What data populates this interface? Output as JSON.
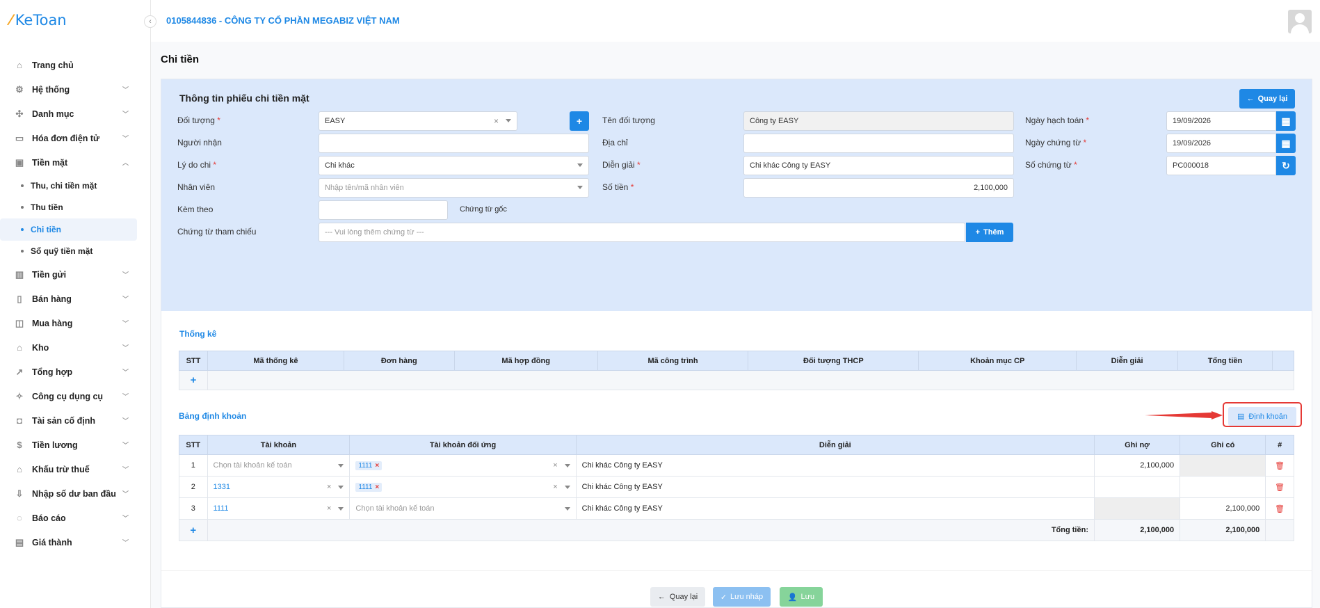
{
  "app": {
    "logo_text": "KeToan",
    "company": "0105844836 - CÔNG TY CỔ PHẦN MEGABIZ VIỆT NAM"
  },
  "sidebar": {
    "items": [
      {
        "label": "Trang chủ",
        "icon": "home-icon"
      },
      {
        "label": "Hệ thống",
        "icon": "gear-icon"
      },
      {
        "label": "Danh mục",
        "icon": "grid-icon"
      },
      {
        "label": "Hóa đơn điện tử",
        "icon": "invoice-icon"
      },
      {
        "label": "Tiền mặt",
        "icon": "cash-icon"
      },
      {
        "label": "Tiền gửi",
        "icon": "bank-icon"
      },
      {
        "label": "Bán hàng",
        "icon": "sale-icon"
      },
      {
        "label": "Mua hàng",
        "icon": "cart-icon"
      },
      {
        "label": "Kho",
        "icon": "warehouse-icon"
      },
      {
        "label": "Tổng hợp",
        "icon": "chart-icon"
      },
      {
        "label": "Công cụ dụng cụ",
        "icon": "tool-icon"
      },
      {
        "label": "Tài sản cố định",
        "icon": "car-icon"
      },
      {
        "label": "Tiền lương",
        "icon": "dollar-icon"
      },
      {
        "label": "Khấu trừ thuế",
        "icon": "tax-icon"
      },
      {
        "label": "Nhập số dư ban đầu",
        "icon": "import-icon"
      },
      {
        "label": "Báo cáo",
        "icon": "report-icon"
      },
      {
        "label": "Giá thành",
        "icon": "price-icon"
      }
    ],
    "subitems": [
      "Thu, chi tiền mặt",
      "Thu tiền",
      "Chi tiền",
      "Sổ quỹ tiền mặt"
    ]
  },
  "page": {
    "title": "Chi tiền",
    "form_title": "Thông tin phiếu chi tiền mặt",
    "back_label": "Quay lại"
  },
  "form": {
    "doi_tuong_label": "Đối tượng",
    "doi_tuong_value": "EASY",
    "ten_doi_tuong_label": "Tên đối tượng",
    "ten_doi_tuong_value": "Công ty EASY",
    "ngay_hach_toan_label": "Ngày hạch toán",
    "ngay_hach_toan_value": "19/09/2026",
    "nguoi_nhan_label": "Người nhận",
    "nguoi_nhan_value": "",
    "dia_chi_label": "Địa chỉ",
    "dia_chi_value": "",
    "ngay_chung_tu_label": "Ngày chứng từ",
    "ngay_chung_tu_value": "19/09/2026",
    "ly_do_chi_label": "Lý do chi",
    "ly_do_chi_value": "Chi khác",
    "dien_giai_label": "Diễn giải",
    "dien_giai_value": "Chi khác Công ty EASY",
    "so_chung_tu_label": "Số chứng từ",
    "so_chung_tu_value": "PC000018",
    "nhan_vien_label": "Nhân viên",
    "nhan_vien_placeholder": "Nhập tên/mã nhân viên",
    "so_tien_label": "Số tiền",
    "so_tien_value": "2,100,000",
    "kem_theo_label": "Kèm theo",
    "kem_theo_value": "",
    "chung_tu_goc_label": "Chứng từ gốc",
    "chung_tu_tham_chieu_label": "Chứng từ tham chiếu",
    "chung_tu_tham_chieu_placeholder": "--- Vui lòng thêm chứng từ ---",
    "them_label": "Thêm"
  },
  "thong_ke": {
    "title": "Thống kê",
    "columns": [
      "STT",
      "Mã thống kê",
      "Đơn hàng",
      "Mã hợp đồng",
      "Mã công trình",
      "Đối tượng THCP",
      "Khoản mục CP",
      "Diễn giải",
      "Tổng tiền",
      ""
    ]
  },
  "dinh_khoan": {
    "title": "Bảng định khoản",
    "button_label": "Định khoản",
    "columns": [
      "STT",
      "Tài khoản",
      "Tài khoản đối ứng",
      "Diễn giải",
      "Ghi nợ",
      "Ghi có",
      "#"
    ],
    "rows": [
      {
        "stt": "1",
        "tai_khoan": "",
        "tai_khoan_placeholder": "Chọn tài khoản kế toán",
        "doi_ung": "1111",
        "doi_ung_placeholder": "",
        "dien_giai": "Chi khác Công ty EASY",
        "ghi_no": "2,100,000",
        "ghi_co": ""
      },
      {
        "stt": "2",
        "tai_khoan": "1331",
        "tai_khoan_placeholder": "",
        "doi_ung": "1111",
        "doi_ung_placeholder": "",
        "dien_giai": "Chi khác Công ty EASY",
        "ghi_no": "",
        "ghi_co": ""
      },
      {
        "stt": "3",
        "tai_khoan": "1111",
        "tai_khoan_placeholder": "",
        "doi_ung": "",
        "doi_ung_placeholder": "Chọn tài khoản kế toán",
        "dien_giai": "Chi khác Công ty EASY",
        "ghi_no": "",
        "ghi_co": "2,100,000"
      }
    ],
    "total_label": "Tổng tiền:",
    "total_no": "2,100,000",
    "total_co": "2,100,000"
  },
  "footer": {
    "back": "Quay lại",
    "save_draft": "Lưu nháp",
    "save": "Lưu"
  },
  "colors": {
    "primary": "#1e88e5",
    "header_bg": "#dbe8fb",
    "danger": "#e53935"
  }
}
